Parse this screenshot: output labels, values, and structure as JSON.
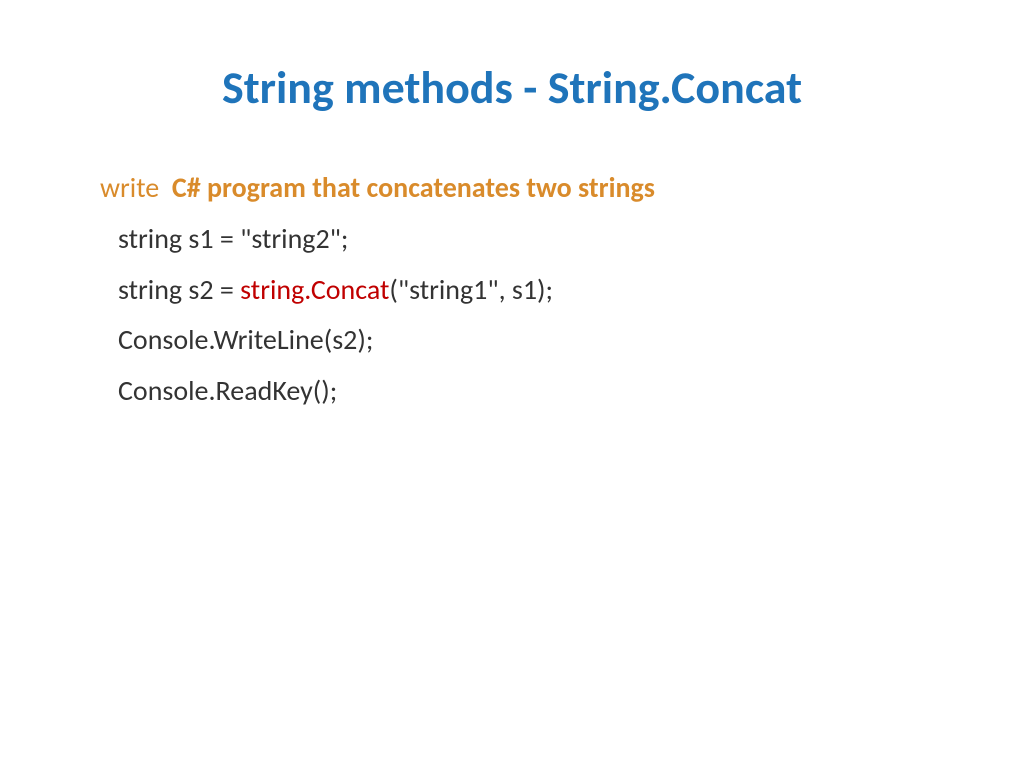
{
  "title": "String methods - String.Concat",
  "line1": {
    "write": "write",
    "desc": "C# program that concatenates two strings"
  },
  "code": {
    "l1": "string s1 = \"string2\";",
    "l2a": "string s2 = ",
    "l2b": "string.Concat",
    "l2c": "(\"string1\", s1);",
    "l3": "Console.WriteLine(s2);",
    "l4": "Console.ReadKey();"
  }
}
